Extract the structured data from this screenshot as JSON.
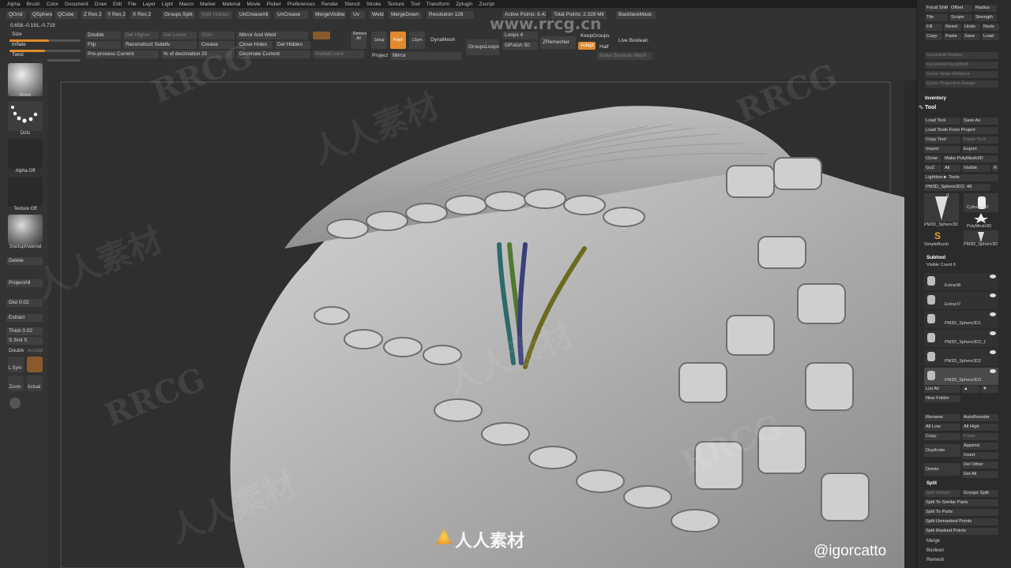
{
  "menu": [
    "Alpha",
    "Brush",
    "Color",
    "Document",
    "Draw",
    "Edit",
    "File",
    "Layer",
    "Light",
    "Macro",
    "Marker",
    "Material",
    "Movie",
    "Picker",
    "Preferences",
    "Render",
    "Stencil",
    "Stroke",
    "Texture",
    "Tool",
    "Transform",
    "Zplugin",
    "Zscript"
  ],
  "topbar": {
    "row1": [
      "QGrid",
      "QSphere",
      "QCube",
      "Z Res 2",
      "Y Res 2",
      "X Res 2",
      "Groups Split",
      "Split Hidden",
      "UnCreaseAll",
      "UnCrease",
      "MergeVisible",
      "Uv",
      "Weld",
      "MergeDown",
      "Resolution 128",
      "Active Points: 6.428",
      "Total Points: 2.328 Mil",
      "BackfaceMask"
    ],
    "coords": "0.658,-0.191,-0.719",
    "size_label": "Size",
    "inflate_label": "Inflate",
    "twist_label": "Twist",
    "double": "Double",
    "del_higher": "Del Higher",
    "del_lower": "Del Lower",
    "sdiv": "SDiv",
    "flip": "Flip",
    "reconstruct": "Reconstruct Subdiv",
    "preprocess": "Pre-process Current",
    "pct_decimation": "% of decimation 20",
    "mirror_weld": "Mirror And Weld",
    "crease": "Crease",
    "close_holes": "Close Holes",
    "del_hidden": "Del Hidden",
    "decimate": "Decimate Current",
    "radial_count": "RadialCount",
    "remesh_all": "Remesh All",
    "dynamesh": "DynaMesh",
    "groups_loops": "GroupsLoops",
    "loops": "Loops 4",
    "gpolish": "GPolish 50",
    "zremesher": "ZRemesher",
    "keep_groups": "KeepGroups",
    "adapt": "Adapt",
    "half": "Half",
    "live_boolean": "Live Boolean",
    "make_boolean": "Make Boolean Mesh",
    "project": "Project",
    "mirror": "Mirror",
    "setup": "Setup",
    "polyf": "PolyF",
    "spivot": "LSym"
  },
  "leftshelf": {
    "move": "Move",
    "dots": "Dots",
    "alpha_off": "Alpha Off",
    "texture_off": "Texture Off",
    "startup_material": "StartupMaterial",
    "delete": "Delete",
    "project_all": "ProjectAll",
    "dist": "Dist 0.02",
    "extract": "Extract",
    "thick": "Thick 0.02",
    "ssmt": "S Smt 5",
    "double": "Double",
    "accept": "Accept",
    "lsym": "L.Sym",
    "zoom": "Zoom",
    "actual": "Actual"
  },
  "rightpanel": {
    "top_items": [
      "Focal Shift",
      "Offset",
      "Radius",
      "Tile",
      "Scope",
      "Strength",
      "Fill",
      "Reset",
      "Undo",
      "Redo",
      "Copy",
      "Paste",
      "Save",
      "Load",
      "CurveEdit Radius",
      "CurveEdit FocalShift",
      "Curve Snap Distance",
      "Curve Projection Range"
    ],
    "inventory": "Inventory",
    "tool_title": "Tool",
    "load_tool": "Load Tool",
    "save_as": "Save As",
    "load_from_project": "Load Tools From Project",
    "copy_tool": "Copy Tool",
    "paste_tool": "Paste Tool",
    "import": "Import",
    "export": "Export",
    "clone": "Clone",
    "make_polymesh": "Make PolyMesh3D",
    "goz": "GoZ",
    "all": "All",
    "visible": "Visible",
    "r": "R",
    "lightbox": "Lightbox► Tools",
    "current_tool": "PM3D_Sphere3D3. 48",
    "thumbs": [
      "PM3D_Sphere3D",
      "Cylinder3D",
      "PolyMesh3D",
      "SimpleBrush",
      "PM3D_Sphere3D"
    ],
    "thumb_num": "9",
    "subtool": "Subtool",
    "visible_count": "Visible Count 6",
    "subtools": [
      "Extract8",
      "Extract7",
      "PM3D_Sphere3D1",
      "PM3D_Sphere3D2_1",
      "PM3D_Sphere3D2",
      "PM3D_Sphere3D3"
    ],
    "list_all": "List All",
    "new_folder": "New Folder",
    "rename": "Rename",
    "auto_reorder": "AutoReorder",
    "all_low": "All Low",
    "all_high": "All High",
    "copy": "Copy",
    "paste": "Paste",
    "duplicate": "Duplicate",
    "append": "Append",
    "insert": "Insert",
    "delete": "Delete",
    "del_other": "Del Other",
    "del_all": "Del All",
    "split": "Split",
    "split_hidden": "Split Hidden",
    "groups_split": "Groups Split",
    "split_similar": "Split To Similar Parts",
    "split_parts": "Split To Parts",
    "split_unmasked": "Split Unmasked Points",
    "split_masked": "Split Masked Points",
    "merge": "Merge",
    "boolean": "Boolean",
    "remesh": "Remesh"
  },
  "watermarks": {
    "rrcg": "RRCG",
    "rrcg_url": "www.rrcg.cn",
    "cn": "人人素材",
    "handle": "@igorcatto",
    "logo_text": "人人素材"
  },
  "colors": {
    "accent": "#e08a2e",
    "bg": "#2a2a2a",
    "panel": "#333333"
  }
}
